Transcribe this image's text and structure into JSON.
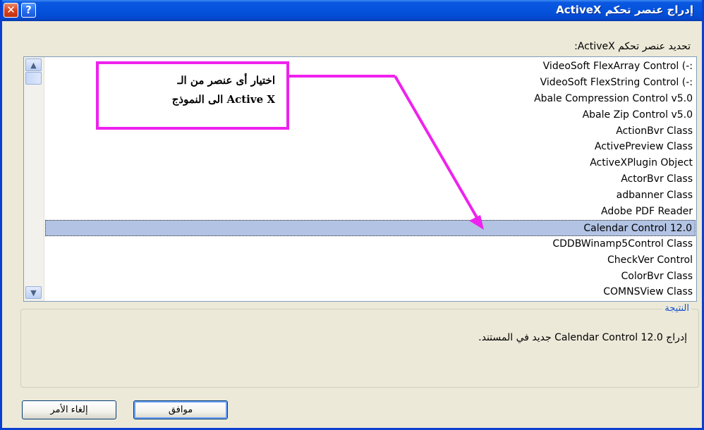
{
  "window": {
    "title": "إدراج عنصر تحكم ActiveX",
    "help_label": "?",
    "close_label": "✕"
  },
  "list": {
    "label": "تحديد عنصر تحكم ActiveX:",
    "items": [
      "VideoSoft FlexArray Control (-:",
      "VideoSoft FlexString Control (-:",
      "Abale Compression Control v5.0",
      "Abale Zip Control v5.0",
      "ActionBvr Class",
      "ActivePreview Class",
      "ActiveXPlugin Object",
      "ActorBvr Class",
      "adbanner Class",
      "Adobe PDF Reader",
      "Calendar Control 12.0",
      "CDDBWinamp5Control Class",
      "CheckVer Control",
      "ColorBvr Class",
      "COMNSView Class"
    ],
    "selected_index": 10
  },
  "callout": {
    "line1": "اختيار أى عنصر من الـ",
    "line2": "Active X الى النموذج",
    "color": "#ee22ee"
  },
  "result": {
    "legend": "النتيجة",
    "text": "إدراج Calendar Control 12.0 جديد في المستند."
  },
  "buttons": {
    "ok": "موافق",
    "cancel": "إلغاء الأمر"
  }
}
